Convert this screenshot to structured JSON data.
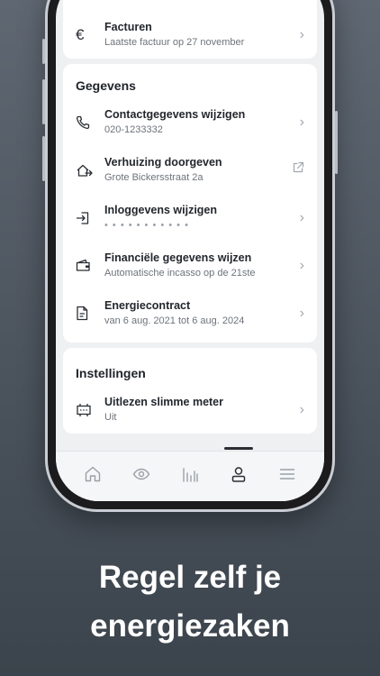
{
  "invoices": {
    "title": "Facturen",
    "subtitle": "Laatste factuur op 27 november"
  },
  "gegevens": {
    "heading": "Gegevens",
    "items": [
      {
        "title": "Contactgegevens wijzigen",
        "subtitle": "020-1233332",
        "icon": "phone-icon",
        "action": "chevron"
      },
      {
        "title": "Verhuizing doorgeven",
        "subtitle": "Grote Bickersstraat 2a",
        "icon": "house-arrow-icon",
        "action": "external-link"
      },
      {
        "title": "Inloggevens wijzigen",
        "subtitle": "• • • • • • • • • • •",
        "icon": "login-icon",
        "action": "chevron"
      },
      {
        "title": "Financiële gegevens wijzen",
        "subtitle": "Automatische incasso op de 21ste",
        "icon": "wallet-icon",
        "action": "chevron"
      },
      {
        "title": "Energiecontract",
        "subtitle": "van 6 aug. 2021 tot 6 aug. 2024",
        "icon": "document-icon",
        "action": "chevron"
      }
    ]
  },
  "instellingen": {
    "heading": "Instellingen",
    "items": [
      {
        "title": "Uitlezen slimme meter",
        "subtitle": "Uit",
        "icon": "smart-meter-icon",
        "action": "chevron"
      }
    ]
  },
  "tabbar": {
    "tabs": [
      {
        "icon": "home-icon",
        "active": false
      },
      {
        "icon": "eye-icon",
        "active": false
      },
      {
        "icon": "bar-chart-icon",
        "active": false
      },
      {
        "icon": "person-icon",
        "active": true
      },
      {
        "icon": "menu-icon",
        "active": false
      }
    ]
  },
  "headline": {
    "line1": "Regel zelf je",
    "line2": "energiezaken"
  },
  "colors": {
    "background_top": "#5f6772",
    "background_bottom": "#3b434c",
    "text_dark": "#23272d",
    "text_muted": "#6d737b"
  }
}
